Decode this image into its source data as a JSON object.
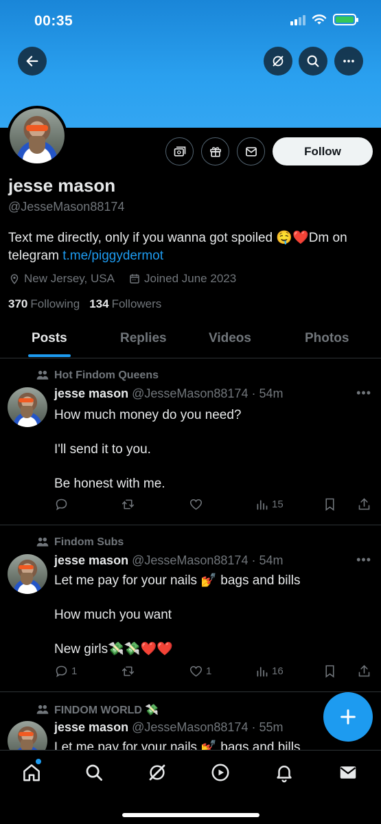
{
  "status_bar": {
    "time": "00:35"
  },
  "profile": {
    "name": "jesse mason",
    "handle": "@JesseMason88174",
    "bio_text": "Text me directly, only if you wanna got spoiled 🤤❤️Dm on telegram ",
    "bio_link": "t.me/piggydermot",
    "location": "New Jersey, USA",
    "joined": "Joined June 2023",
    "following_count": "370",
    "following_label": "Following",
    "followers_count": "134",
    "followers_label": "Followers",
    "follow_button": "Follow"
  },
  "tabs": [
    "Posts",
    "Replies",
    "Videos",
    "Photos"
  ],
  "active_tab": "Posts",
  "posts": [
    {
      "community": "Hot Findom Queens",
      "name": "jesse mason",
      "handle_time": "@JesseMason88174 · 54m",
      "lines": [
        "How much money do you need?",
        "",
        "I'll send it to you.",
        "",
        "Be honest with me."
      ],
      "replies": "",
      "reposts": "",
      "likes": "",
      "views": "15"
    },
    {
      "community": "Findom Subs",
      "name": "jesse mason",
      "handle_time": "@JesseMason88174 · 54m",
      "lines": [
        "Let me pay for your nails 💅 bags and bills",
        "",
        "How much you want",
        "",
        "New girls💸💸❤️❤️"
      ],
      "replies": "1",
      "reposts": "",
      "likes": "1",
      "views": "16"
    },
    {
      "community": "FINDOM WORLD 💸",
      "name": "jesse mason",
      "handle_time": "@JesseMason88174 · 55m",
      "lines": [
        "Let me pay for your nails 💅 bags and bills"
      ]
    }
  ],
  "colors": {
    "accent": "#1d9bf0",
    "banner": "#2aa0ef",
    "background": "#000000",
    "muted": "#71767b",
    "battery": "#34c759"
  },
  "icons": {
    "back": "back-arrow-icon",
    "grok": "grok-icon",
    "search": "search-icon",
    "more": "more-horizontal-icon",
    "subscribe": "subscriptions-icon",
    "gift": "gift-icon",
    "message": "mail-icon",
    "compose": "plus-icon"
  }
}
